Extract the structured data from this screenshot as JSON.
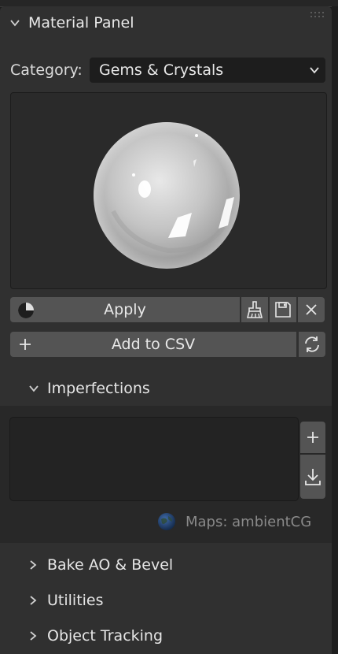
{
  "panel": {
    "title": "Material Panel"
  },
  "category": {
    "label": "Category:",
    "value": "Gems & Crystals"
  },
  "preview": {
    "description_icon": "sphere-preview"
  },
  "actions": {
    "apply_label": "Apply",
    "add_csv_label": "Add to CSV"
  },
  "icons": {
    "apply": "half-circle-shading-icon",
    "brush": "brush-icon",
    "save": "floppy-disk-icon",
    "close": "close-icon",
    "plus": "plus-icon",
    "refresh": "refresh-icon",
    "download": "download-icon",
    "globe": "globe-icon",
    "grip": "drag-grip-icon"
  },
  "imperfections": {
    "label": "Imperfections"
  },
  "maps": {
    "label": "Maps: ambientCG"
  },
  "collapsed_sections": [
    {
      "label": "Bake AO & Bevel"
    },
    {
      "label": "Utilities"
    },
    {
      "label": "Object Tracking"
    }
  ],
  "colors": {
    "panel_bg": "#303030",
    "button_bg": "#545454",
    "field_bg": "#1d1d1d"
  }
}
